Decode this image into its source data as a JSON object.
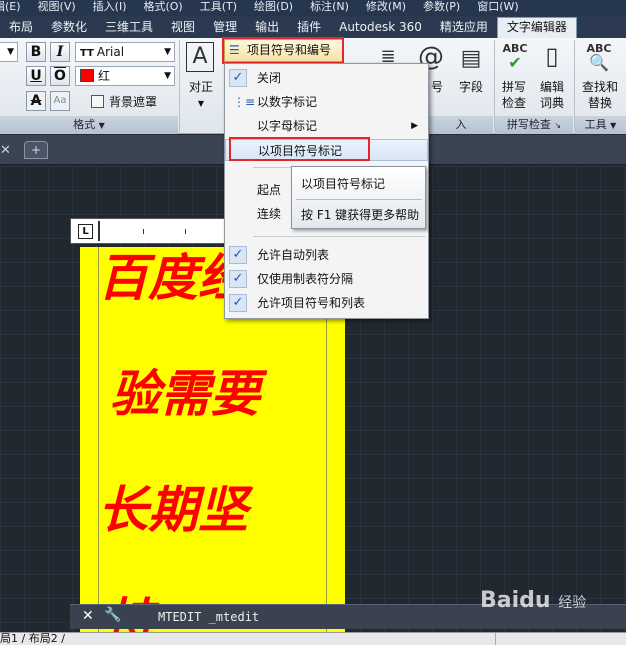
{
  "menu_bar": {
    "items": [
      "辑(E)",
      "视图(V)",
      "插入(I)",
      "格式(O)",
      "工具(T)",
      "绘图(D)",
      "标注(N)",
      "修改(M)",
      "参数(P)",
      "窗口(W)"
    ]
  },
  "ribbon_tabs": {
    "items": [
      "布局",
      "参数化",
      "三维工具",
      "视图",
      "管理",
      "输出",
      "插件",
      "Autodesk 360",
      "精选应用",
      "文字编辑器"
    ],
    "active": "文字编辑器"
  },
  "ribbon": {
    "bold_label": "B",
    "italic_label": "I",
    "underline_label": "U",
    "overline_label": "O",
    "strike_label": "A",
    "case_label": "Aa",
    "font_icon": "TT",
    "font_value": "Arial",
    "color_value": "红",
    "color_hex": "#ff0000",
    "bg_mask_label": "背景遮罩",
    "format_group_label": "格式",
    "align_label": "对正",
    "bullets_button_label": "项目符号和编号",
    "symbol_label": "号",
    "field_label": "字段",
    "insert_group_label": "入",
    "spell_check_label_1": "拼写",
    "spell_check_label_2": "检查",
    "edit_dict_label_1": "编辑",
    "edit_dict_label_2": "词典",
    "find_replace_label_1": "查找和",
    "find_replace_label_2": "替换",
    "spell_group_label": "拼写检查",
    "tools_group_label": "工具"
  },
  "dropdown": {
    "items": [
      {
        "label": "关闭",
        "checked": true
      },
      {
        "label": "以数字标记",
        "icon": "numbered-list-icon"
      },
      {
        "label": "以字母标记",
        "submenu": true
      },
      {
        "label": "以项目符号标记",
        "highlighted": true
      },
      {
        "label": "起点"
      },
      {
        "label": "连续"
      },
      {
        "label": "允许自动列表",
        "checked": true
      },
      {
        "label": "仅使用制表符分隔",
        "checked": true
      },
      {
        "label": "允许项目符号和列表",
        "checked": true
      }
    ]
  },
  "tooltip": {
    "title": "以项目符号标记",
    "help": "按 F1 键获得更多帮助"
  },
  "ruler": {
    "tab_label": "L"
  },
  "drawing_text": {
    "line1": "百度经",
    "line2": "验需要",
    "line3": "长期坚",
    "line4": "持"
  },
  "command_line": {
    "close": "✕",
    "wrench": "🔧",
    "text": "MTEDIT _mtedit"
  },
  "status_bar": {
    "layouts": "局1 ∕ 布局2 ∕"
  },
  "watermark": {
    "text": "Baidu",
    "sub": "经验"
  },
  "doc_tabs": {
    "close": "✕"
  }
}
